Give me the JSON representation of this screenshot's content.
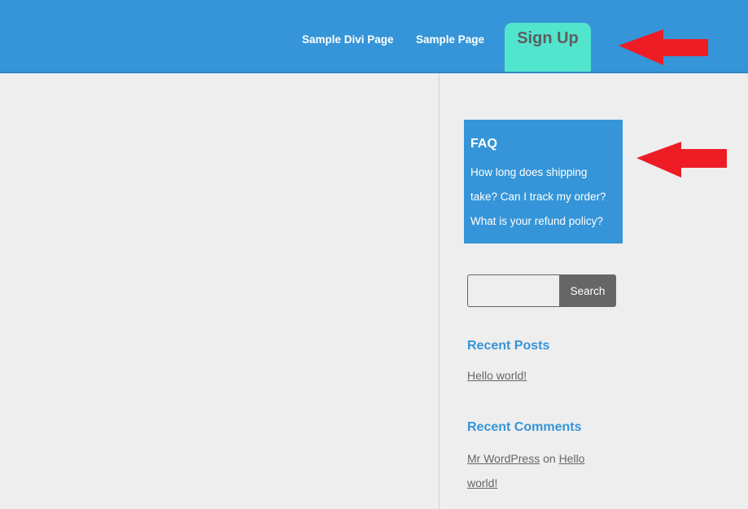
{
  "header": {
    "nav_items": [
      {
        "label": "Sample Divi Page"
      },
      {
        "label": "Sample Page"
      }
    ],
    "signup_label": "Sign Up",
    "colors": {
      "header_bg": "#3595d8",
      "signup_bg": "#52e5ce",
      "arrow": "#ee1c25"
    }
  },
  "annotations": {
    "arrow_top": "arrow-left-icon",
    "arrow_faq": "arrow-left-icon"
  },
  "sidebar": {
    "faq": {
      "title": "FAQ",
      "text": "How long does shipping take? Can I track my order? What is your refund policy?"
    },
    "search": {
      "placeholder": "",
      "value": "",
      "button_label": "Search"
    },
    "recent_posts": {
      "title": "Recent Posts",
      "items": [
        {
          "label": "Hello world!"
        }
      ]
    },
    "recent_comments": {
      "title": "Recent Comments",
      "items": [
        {
          "author": "Mr WordPress",
          "connector": " on ",
          "post": "Hello world!"
        }
      ]
    }
  }
}
